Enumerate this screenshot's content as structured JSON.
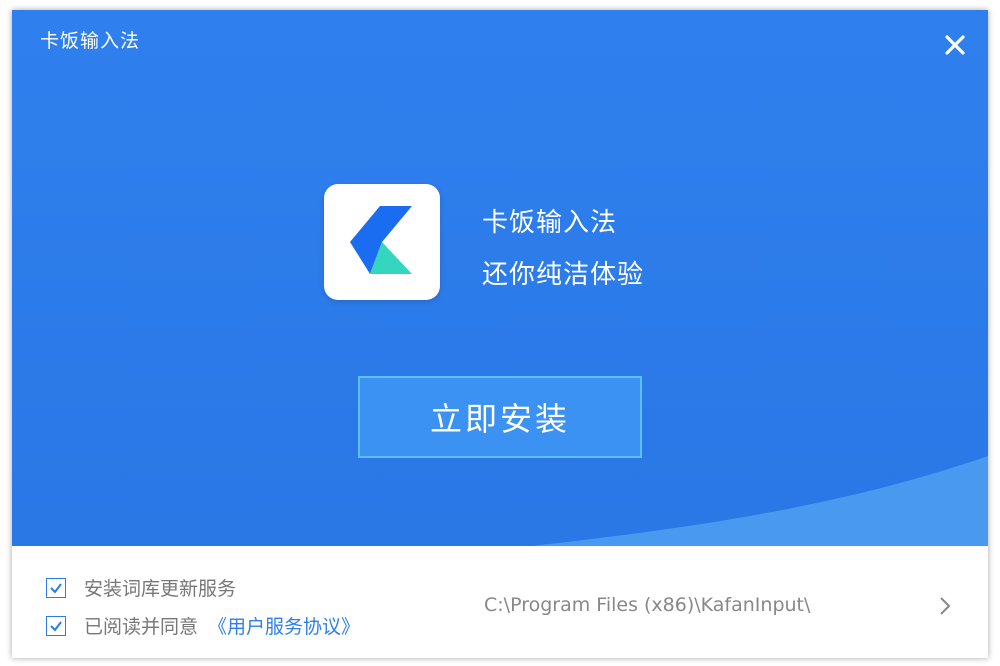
{
  "window": {
    "title": "卡饭输入法"
  },
  "hero": {
    "slogan_line1": "卡饭输入法",
    "slogan_line2": "还你纯洁体验",
    "install_label": "立即安装"
  },
  "footer": {
    "option1_label": "安装词库更新服务",
    "option1_checked": true,
    "option2_label": "已阅读并同意",
    "option2_checked": true,
    "agreement_link": "《用户服务协议》",
    "install_path": "C:\\Program Files (x86)\\KafanInput\\"
  },
  "icons": {
    "close": "close-icon",
    "check": "checkmark-icon",
    "chevron": "chevron-right-icon",
    "logo": "kafan-logo"
  },
  "colors": {
    "primary_blue": "#2f80ee",
    "button_blue": "#3b92f3",
    "button_border": "#5cc0f6",
    "logo_blue": "#1a6cf0",
    "logo_teal": "#35d6c0",
    "link_blue": "#2f7fe8"
  }
}
